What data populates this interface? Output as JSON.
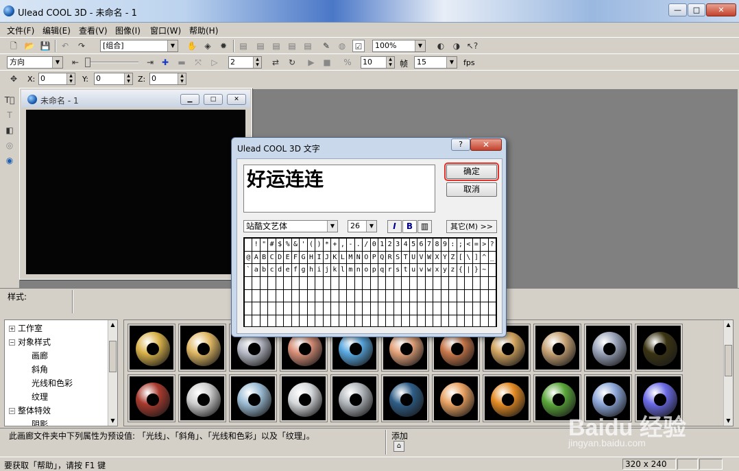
{
  "window": {
    "title": "Ulead COOL 3D - 未命名 - 1",
    "minimize": "—",
    "maximize": "□",
    "close": "✕"
  },
  "menu": [
    "文件(F)",
    "编辑(E)",
    "查看(V)",
    "图像(I)",
    "窗口(W)",
    "帮助(H)"
  ],
  "toolbar1": {
    "group_combo": "[组合]",
    "zoom_combo": "100%"
  },
  "toolbar2": {
    "mode_combo": "方向",
    "step_value": "2",
    "frames_value": "10",
    "frame_label": "帧",
    "fps_value": "15",
    "fps_label": "fps"
  },
  "toolbar3": {
    "x_label": "X:",
    "x_value": "0",
    "y_label": "Y:",
    "y_value": "0",
    "z_label": "Z:",
    "z_value": "0"
  },
  "child_window": {
    "title": "未命名 - 1"
  },
  "dialog": {
    "title": "Ulead COOL 3D 文字",
    "help": "?",
    "close": "✕",
    "text": "好运连连",
    "ok_label": "确定",
    "cancel_label": "取消",
    "font": "站酷文艺体",
    "size": "26",
    "italic": "I",
    "bold": "B",
    "other_label": "其它(M) >>",
    "char_rows": [
      [
        " ",
        "!",
        "\"",
        "#",
        "$",
        "%",
        "&",
        "'",
        "(",
        ")",
        "*",
        "+",
        ",",
        "-",
        ".",
        "/",
        "0",
        "1",
        "2",
        "3",
        "4",
        "5",
        "6",
        "7",
        "8",
        "9",
        ":",
        ";",
        "<",
        "=",
        ">",
        "?"
      ],
      [
        "@",
        "A",
        "B",
        "C",
        "D",
        "E",
        "F",
        "G",
        "H",
        "I",
        "J",
        "K",
        "L",
        "M",
        "N",
        "O",
        "P",
        "Q",
        "R",
        "S",
        "T",
        "U",
        "V",
        "W",
        "X",
        "Y",
        "Z",
        "[",
        "\\",
        "]",
        "^",
        "_"
      ],
      [
        "`",
        "a",
        "b",
        "c",
        "d",
        "e",
        "f",
        "g",
        "h",
        "i",
        "j",
        "k",
        "l",
        "m",
        "n",
        "o",
        "p",
        "q",
        "r",
        "s",
        "t",
        "u",
        "v",
        "w",
        "x",
        "y",
        "z",
        "{",
        "|",
        "}",
        "~",
        ""
      ]
    ]
  },
  "style_panel": {
    "label": "样式:"
  },
  "tree": {
    "items": [
      {
        "label": "工作室",
        "toggle": "+"
      },
      {
        "label": "对象样式",
        "toggle": "−"
      },
      {
        "label": "画廊",
        "toggle": ""
      },
      {
        "label": "斜角",
        "toggle": ""
      },
      {
        "label": "光线和色彩",
        "toggle": ""
      },
      {
        "label": "纹理",
        "toggle": ""
      },
      {
        "label": "整体特效",
        "toggle": "−"
      },
      {
        "label": "阴影",
        "toggle": ""
      }
    ]
  },
  "gallery_colors": [
    "#d9b24a",
    "#e0b864",
    "#b9bcc8",
    "#d98f78",
    "#58a8e0",
    "#e4a27a",
    "#c9784a",
    "#d1a35f",
    "#c6a274",
    "#9aa3ba",
    "#3a3312",
    "#a83a2e",
    "#cfcfcf",
    "#9bbcd4",
    "#d6d9dc",
    "#b1b6bb",
    "#2e5d86",
    "#e8a060",
    "#e38a23",
    "#5aa63a",
    "#8ca6d8",
    "#6a6ae6"
  ],
  "hint": {
    "text": "此画廊文件夹中下列属性为预设值: 「光线」、「斜角」、「光线和色彩」以及「纹理」。",
    "add_label": "添加"
  },
  "status": {
    "text": "要获取「帮助」，请按 F1 键",
    "size": "320 x 240"
  },
  "watermark": {
    "brand": "Baidu 经验",
    "url": "jingyan.baidu.com"
  }
}
